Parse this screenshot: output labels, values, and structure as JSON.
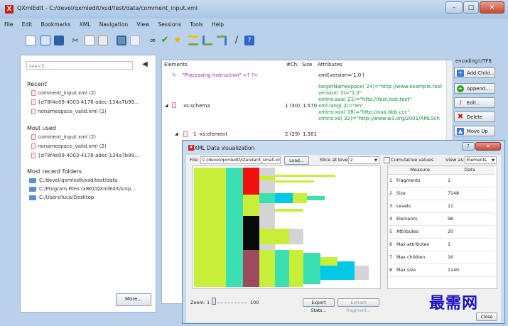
{
  "window": {
    "title": "QXmlEdit - C:/devel/qxmledit/xsd/test/data/comment_input.xml",
    "minimize": "–",
    "maximize": "□",
    "close": "✕"
  },
  "menu": [
    "File",
    "Edit",
    "Bookmarks",
    "XML",
    "Navigation",
    "View",
    "Sessions",
    "Tools",
    "Help"
  ],
  "toolbar_icons": [
    "new-icon",
    "open-icon",
    "save-icon",
    "cut-icon",
    "copy-icon",
    "paste-icon",
    "view-icon",
    "view-list-icon",
    "binoculars-icon",
    "check-icon",
    "star-icon",
    "tree-expand-icon",
    "tree-move-icon",
    "tree-collapse-icon",
    "pen-icon",
    "help-icon"
  ],
  "left": {
    "search_placeholder": "search...",
    "search_clear": "◀",
    "recent_title": "Recent",
    "recent": [
      "comment_input.xml (2)",
      "{d78f4e09-4003-4178-adec-134a7b99...",
      "nonamespace_valid.xml (2)"
    ],
    "most_used_title": "Most used",
    "most_used": [
      "comment_input.xml (2)",
      "nonamespace_valid.xml (2)",
      "{d78f4e09-4003-4178-adec-134a7b99..."
    ],
    "folders_title": "Most recent folders",
    "folders": [
      "C:/devel/qxmledit/xsd/test/data",
      "C:/Program Files (x86)/QXmlEdit/snip...",
      "C:/Users/luca/Desktop"
    ],
    "more": "More..."
  },
  "tree": {
    "headers": {
      "elements": "Elements",
      "ch": "#Ch.",
      "size": "Size",
      "attributes": "Attributes"
    },
    "rows": [
      {
        "label": "\"Processing Instruction\" <? ?>",
        "ch": "",
        "size": "",
        "attr": [
          "xml(version='1.0')"
        ]
      },
      {
        "label": "xs:schema",
        "ch": "1 (30)",
        "size": "1.570",
        "attr": [
          "targetNamespace( 24)=\"http://www.example.test",
          "version( 3)=\"1.0\"",
          "xmlns:aaa( 21)=\"http://test.test.test\"",
          "xml:lang( 2)=\"en\"",
          "xmlns:xxx( 18)=\"http://aaa.bbb.ccc\"",
          "xmlns:xs( 32)=\"http://www.w3.org/2001/XMLSch"
        ]
      },
      {
        "label": "1 -xs:element",
        "ch": "2 (29)",
        "size": "1.301",
        "attr": []
      }
    ]
  },
  "side": {
    "encoding": "encoding:UTF8",
    "buttons": [
      "Add Child...",
      "Append...",
      "Edit...",
      "Delete",
      "Move Up"
    ]
  },
  "dialog": {
    "title": "XML Data visualization",
    "file_label": "File:",
    "file_value": "C:/devel/qxmledit/standard_small.xml",
    "load": "Load...",
    "slice_label": "Slice at level:",
    "slice_value": "2",
    "cumulative": "Cumulative values",
    "view_as_label": "View as:",
    "view_as_value": "Elements",
    "zoom_label": "Zoom:",
    "zoom_min": "1",
    "zoom_max": "100",
    "export": "Export Stats...",
    "extract": "Extract fragment...",
    "close": "Close",
    "stats_headers": [
      "Measure",
      "Data"
    ],
    "stats": [
      {
        "n": "1",
        "measure": "Fragments",
        "data": "1"
      },
      {
        "n": "2",
        "measure": "Size",
        "data": "7148"
      },
      {
        "n": "3",
        "measure": "Levels",
        "data": "11"
      },
      {
        "n": "4",
        "measure": "Elements",
        "data": "96"
      },
      {
        "n": "5",
        "measure": "Attributes",
        "data": "20"
      },
      {
        "n": "6",
        "measure": "Max attributes",
        "data": "1"
      },
      {
        "n": "7",
        "measure": "Max children",
        "data": "16"
      },
      {
        "n": "8",
        "measure": "Max size",
        "data": "1140"
      }
    ]
  },
  "watermark": "最需网"
}
